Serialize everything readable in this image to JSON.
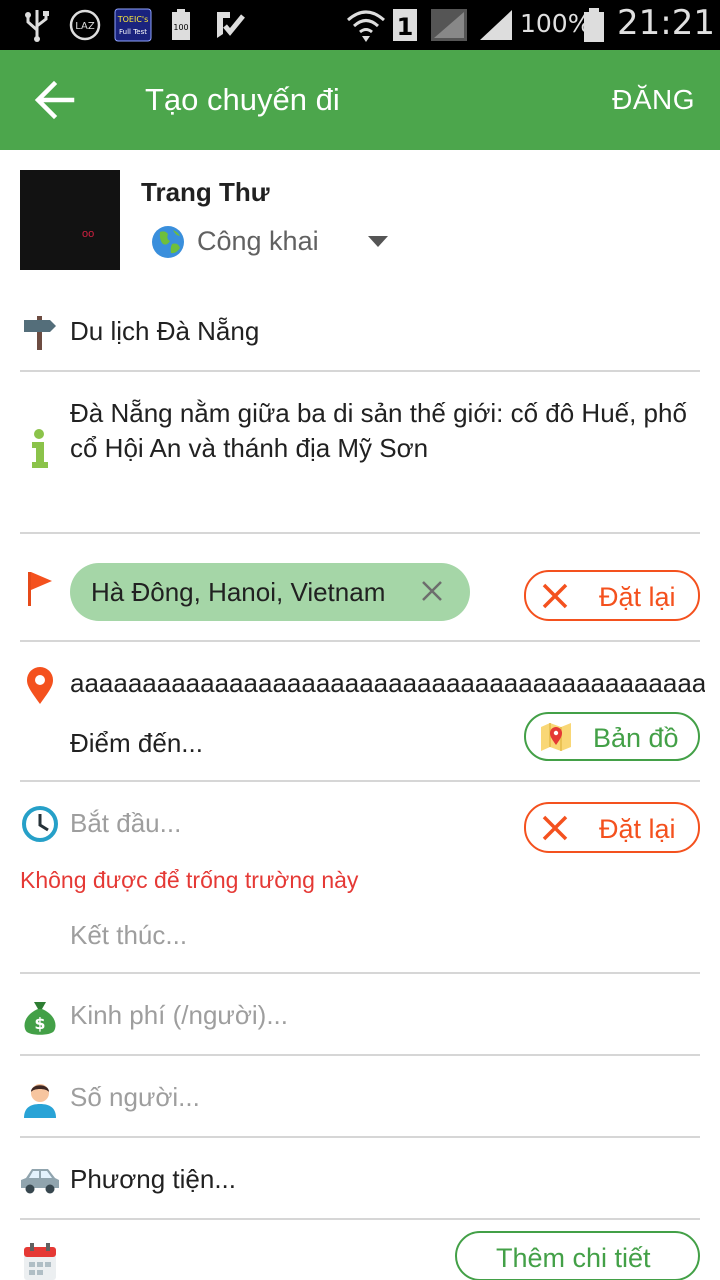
{
  "status_bar": {
    "battery": "100%",
    "time": "21:21",
    "notification_icons": [
      "usb-icon",
      "laz-icon",
      "toeic-app-icon",
      "battery-100-icon",
      "checkmark-app-icon"
    ],
    "system_icons": [
      "wifi-icon",
      "sim-1-icon",
      "signal-weak-icon",
      "signal-icon",
      "battery-icon"
    ]
  },
  "app_bar": {
    "title": "Tạo chuyến đi",
    "action": "ĐĂNG",
    "background": "#4ca64c"
  },
  "user": {
    "name": "Trang Thư",
    "privacy": "Công khai"
  },
  "form": {
    "title_value": "Du lịch Đà Nẵng",
    "description": "Đà Nẵng nằm giữa ba di sản thế giới: cố đô Huế, phố cổ Hội An và thánh địa Mỹ Sơn",
    "start_location_chip": "Hà Đông, Hanoi, Vietnam",
    "reset_label": "Đặt lại",
    "destination_value": "aaaaaaaaaaaaaaaaaaaaaaaaaaaaaaaaaaaaaaaaaaaaaaaa",
    "destination_placeholder": "Điểm đến...",
    "map_label": "Bản đồ",
    "start_time_placeholder": "Bắt đầu...",
    "start_time_error": "Không được để trống trường này",
    "end_time_placeholder": "Kết thúc...",
    "cost_placeholder": "Kinh phí (/người)...",
    "people_placeholder": "Số người...",
    "transport_placeholder": "Phương tiện...",
    "more_details_label": "Thêm chi tiết"
  },
  "colors": {
    "accent_green": "#4ca64c",
    "chip_green": "#a5d6a7",
    "reset_red": "#f4511e",
    "error_red": "#e53935",
    "map_green": "#43a047"
  }
}
